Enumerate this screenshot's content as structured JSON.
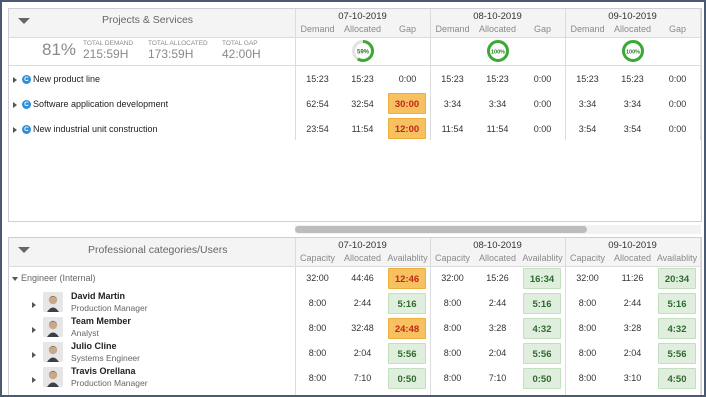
{
  "projects_panel": {
    "title": "Projects & Services",
    "summary": {
      "percent": "81%",
      "total_demand_label": "TOTAL DEMAND",
      "total_demand": "215:59H",
      "total_allocated_label": "TOTAL ALLOCATED",
      "total_allocated": "173:59H",
      "total_gap_label": "TOTAL GAP",
      "total_gap": "42:00H"
    },
    "dates": [
      {
        "date": "07-10-2019",
        "ring": "59%",
        "ring_value": 0.59
      },
      {
        "date": "08-10-2019",
        "ring": "100%",
        "ring_value": 1.0
      },
      {
        "date": "09-10-2019",
        "ring": "100%",
        "ring_value": 1.0
      }
    ],
    "col_labels": [
      "Demand",
      "Allocated",
      "Gap"
    ],
    "rows": [
      {
        "name": "New product line",
        "cells": [
          [
            "15:23",
            "15:23",
            "0:00"
          ],
          [
            "15:23",
            "15:23",
            "0:00"
          ],
          [
            "15:23",
            "15:23",
            "0:00"
          ]
        ]
      },
      {
        "name": "Software application development",
        "cells": [
          [
            "62:54",
            "32:54",
            "30:00"
          ],
          [
            "3:34",
            "3:34",
            "0:00"
          ],
          [
            "3:34",
            "3:34",
            "0:00"
          ]
        ]
      },
      {
        "name": "New industrial unit construction",
        "cells": [
          [
            "23:54",
            "11:54",
            "12:00"
          ],
          [
            "11:54",
            "11:54",
            "0:00"
          ],
          [
            "3:54",
            "3:54",
            "0:00"
          ]
        ]
      }
    ],
    "icon_letter": "C"
  },
  "users_panel": {
    "title": "Professional categories/Users",
    "dates": [
      "07-10-2019",
      "08-10-2019",
      "09-10-2019"
    ],
    "col_labels": [
      "Capacity",
      "Allocated",
      "Availablity"
    ],
    "category": {
      "name": "Engineer (Internal)",
      "cells": [
        [
          "32:00",
          "44:46",
          "12:46"
        ],
        [
          "32:00",
          "15:26",
          "16:34"
        ],
        [
          "32:00",
          "11:26",
          "20:34"
        ]
      ]
    },
    "users": [
      {
        "name": "David Martin",
        "role": "Production Manager",
        "cells": [
          [
            "8:00",
            "2:44",
            "5:16"
          ],
          [
            "8:00",
            "2:44",
            "5:16"
          ],
          [
            "8:00",
            "2:44",
            "5:16"
          ]
        ]
      },
      {
        "name": "Team Member",
        "role": "Analyst",
        "cells": [
          [
            "8:00",
            "32:48",
            "24:48"
          ],
          [
            "8:00",
            "3:28",
            "4:32"
          ],
          [
            "8:00",
            "3:28",
            "4:32"
          ]
        ]
      },
      {
        "name": "Julio Cline",
        "role": "Systems Engineer",
        "cells": [
          [
            "8:00",
            "2:04",
            "5:56"
          ],
          [
            "8:00",
            "2:04",
            "5:56"
          ],
          [
            "8:00",
            "2:04",
            "5:56"
          ]
        ]
      },
      {
        "name": "Travis Orellana",
        "role": "Production Manager",
        "cells": [
          [
            "8:00",
            "7:10",
            "0:50"
          ],
          [
            "8:00",
            "7:10",
            "0:50"
          ],
          [
            "8:00",
            "3:10",
            "4:50"
          ]
        ]
      }
    ]
  },
  "colors": {
    "ring_green": "#3aaa35",
    "gap_orange": "#f7c060",
    "avail_green": "#dfeedd",
    "frame": "#4a5a70"
  }
}
